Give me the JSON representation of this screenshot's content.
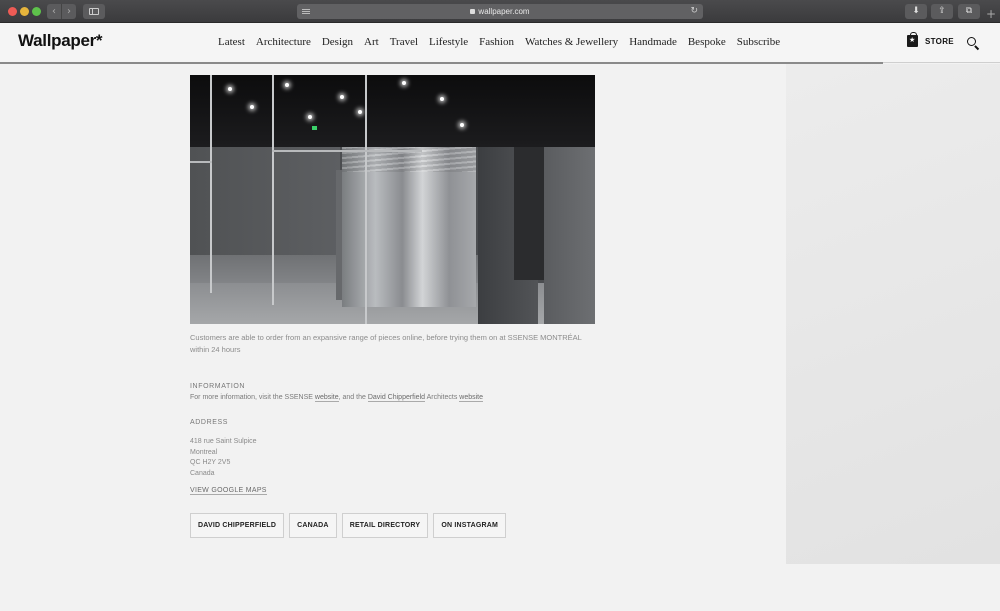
{
  "browser": {
    "url": "wallpaper.com",
    "back_glyph": "‹",
    "forward_glyph": "›",
    "reload_glyph": "↻",
    "download_glyph": "⬇",
    "share_glyph": "⇪",
    "tabs_glyph": "⧉",
    "new_tab_glyph": "+"
  },
  "site": {
    "logo": "Wallpaper*",
    "nav": [
      "Latest",
      "Architecture",
      "Design",
      "Art",
      "Travel",
      "Lifestyle",
      "Fashion",
      "Watches & Jewellery",
      "Handmade",
      "Bespoke",
      "Subscribe"
    ],
    "store_label": "STORE"
  },
  "article": {
    "caption": "Customers are able to order from an expansive range of pieces online, before trying them on at SSENSE MONTRÉAL within 24 hours",
    "information_label": "INFORMATION",
    "info_prefix": "For more information, visit the SSENSE ",
    "info_link1": "website",
    "info_mid": ", and the ",
    "info_link2": "David Chipperfield",
    "info_mid2": " Architects ",
    "info_link3": "website",
    "address_label": "ADDRESS",
    "address": [
      "418 rue Saint Sulpice",
      "Montreal",
      "QC H2Y 2V5",
      "Canada"
    ],
    "maps_link": "VIEW GOOGLE MAPS",
    "tags": [
      "DAVID CHIPPERFIELD",
      "CANADA",
      "RETAIL DIRECTORY",
      "ON INSTAGRAM"
    ]
  },
  "colors": {
    "page_bg": "#f2f2f2",
    "text_dark": "#111111",
    "caption_grey": "#8c8c8c"
  }
}
